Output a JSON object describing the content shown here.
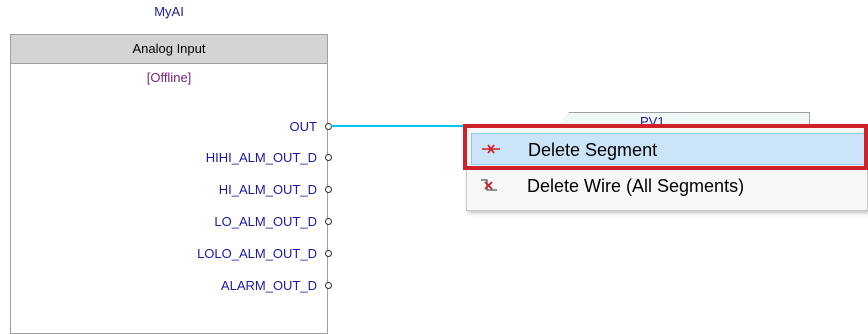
{
  "block": {
    "name": "MyAI",
    "type": "Analog Input",
    "status": "[Offline]",
    "ports": [
      "OUT",
      "HIHI_ALM_OUT_D",
      "HI_ALM_OUT_D",
      "LO_ALM_OUT_D",
      "LOLO_ALM_OUT_D",
      "ALARM_OUT_D"
    ]
  },
  "target": {
    "label": "PV1"
  },
  "context_menu": {
    "items": [
      {
        "label": "Delete Segment",
        "icon": "delete-segment-icon"
      },
      {
        "label": "Delete Wire (All Segments)",
        "icon": "delete-wire-icon"
      }
    ]
  },
  "colors": {
    "wire": "#00c8e6",
    "port_text": "#1a1aa6",
    "status_text": "#7a1f7a",
    "highlight_border": "#d0202a",
    "selected_item_bg": "#cce4f7"
  }
}
